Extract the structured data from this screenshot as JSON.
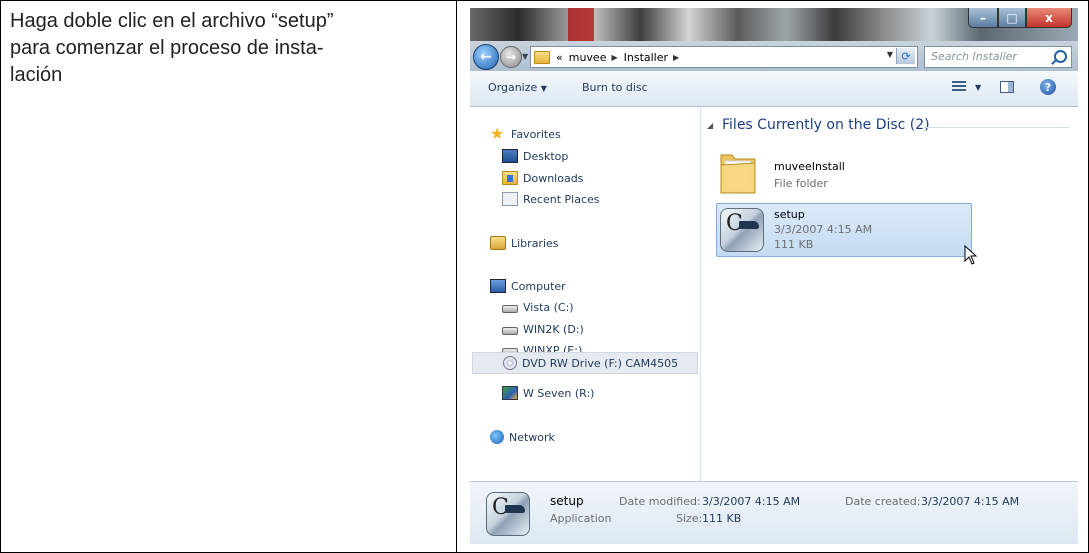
{
  "instruction": "Haga doble clic en el archivo “setup” para comenzar el proceso de insta-lación",
  "instruction_lines": [
    "Haga doble clic en el archivo “setup”",
    "para comenzar el proceso de insta-",
    "lación"
  ],
  "window": {
    "controls": {
      "minimize": "–",
      "maximize": "□",
      "close": "x"
    },
    "address": {
      "overflow": "«",
      "crumbs": [
        "muvee",
        "Installer"
      ],
      "search_placeholder": "Search Installer"
    },
    "toolbar": {
      "organize": "Organize",
      "burn": "Burn to disc",
      "help": "?"
    },
    "nav": {
      "favorites": "Favorites",
      "desktop": "Desktop",
      "downloads": "Downloads",
      "recent_places": "Recent Places",
      "libraries": "Libraries",
      "computer": "Computer",
      "drives": [
        "Vista (C:)",
        "WIN2K (D:)",
        "WINXP (E:)",
        "DVD RW Drive (F:) CAM4505",
        "W Seven (R:)"
      ],
      "network": "Network"
    },
    "content": {
      "group_header": "Files Currently on the Disc (2)",
      "files": [
        {
          "name": "muveeInstall",
          "type": "File folder"
        },
        {
          "name": "setup",
          "date": "3/3/2007 4:15 AM",
          "size": "111 KB"
        }
      ]
    },
    "details": {
      "name": "setup",
      "type": "Application",
      "date_modified_label": "Date modified:",
      "date_modified": "3/3/2007 4:15 AM",
      "size_label": "Size:",
      "size": "111 KB",
      "date_created_label": "Date created:",
      "date_created": "3/3/2007 4:15 AM"
    }
  }
}
